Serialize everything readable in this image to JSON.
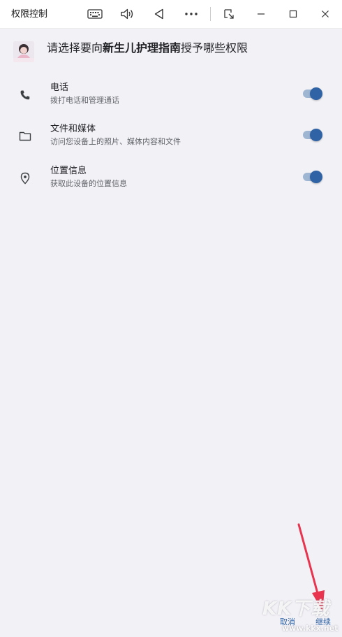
{
  "window": {
    "title": "权限控制",
    "toolbar_icons": [
      "keyboard-icon",
      "volume-icon",
      "back-triangle-icon",
      "more-icon",
      "screen-rotate-icon"
    ],
    "controls": [
      "minimize-icon",
      "maximize-icon",
      "close-icon"
    ]
  },
  "header": {
    "prefix": "请选择要向",
    "app_name": "新生儿护理指南",
    "suffix": "授予哪些权限"
  },
  "permissions": [
    {
      "title": "电话",
      "desc": "拨打电话和管理通话",
      "icon": "phone-icon",
      "enabled": true
    },
    {
      "title": "文件和媒体",
      "desc": "访问您设备上的照片、媒体内容和文件",
      "icon": "folder-icon",
      "enabled": true
    },
    {
      "title": "位置信息",
      "desc": "获取此设备的位置信息",
      "icon": "location-pin-icon",
      "enabled": true
    }
  ],
  "footer": {
    "cancel_label": "取消",
    "continue_label": "继续"
  },
  "watermark": {
    "logo": "KK下载",
    "url": "www.kkx.net"
  },
  "colors": {
    "accent": "#2f63a5",
    "toggle_track": "#9fb6d3",
    "background": "#f2f1f6",
    "annotation_arrow": "#e8344e"
  }
}
